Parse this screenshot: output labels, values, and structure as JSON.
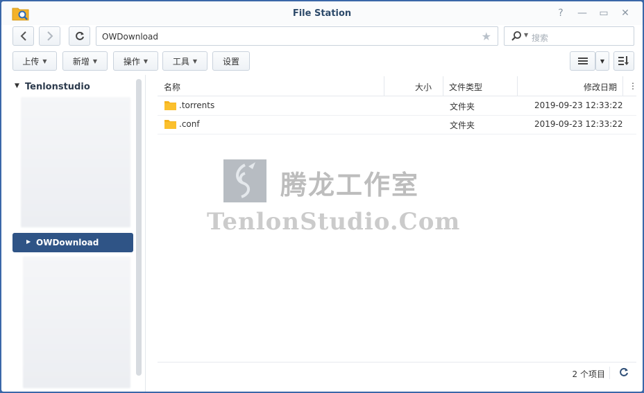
{
  "window": {
    "title": "File Station"
  },
  "titlebar_buttons": [
    "?",
    "—",
    "▭",
    "✕"
  ],
  "nav": {
    "path": "OWDownload",
    "search_placeholder": "搜索"
  },
  "actions": {
    "upload": "上传",
    "create": "新增",
    "action": "操作",
    "tools": "工具",
    "settings": "设置"
  },
  "sidebar": {
    "root": "Tenlonstudio",
    "selected": "OWDownload"
  },
  "table": {
    "columns": {
      "name": "名称",
      "size": "大小",
      "type": "文件类型",
      "modified": "修改日期"
    },
    "rows": [
      {
        "name": ".torrents",
        "size": "",
        "type": "文件夹",
        "modified": "2019-09-23 12:33:22"
      },
      {
        "name": ".conf",
        "size": "",
        "type": "文件夹",
        "modified": "2019-09-23 12:33:22"
      }
    ]
  },
  "watermark": {
    "cn": "腾龙工作室",
    "en": "TenlonStudio.Com"
  },
  "status": {
    "count": "2 个项目"
  },
  "colors": {
    "window_frame": "#3a67a8",
    "selected": "#2f5486",
    "folder": "#f5b31d"
  }
}
